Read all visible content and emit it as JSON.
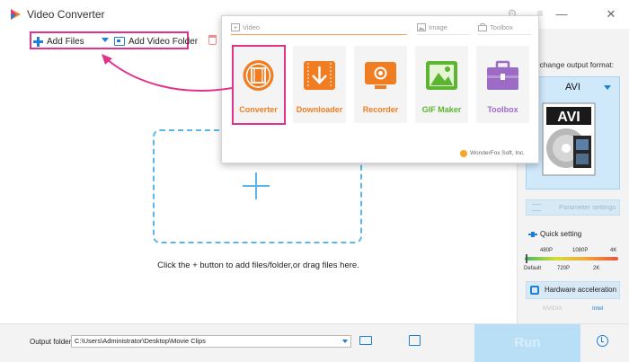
{
  "window": {
    "title": "Video Converter",
    "minimize_glyph": "—",
    "close_glyph": "✕"
  },
  "toolbar": {
    "add_files_label": "Add Files",
    "add_video_folder_label": "Add Video Folder"
  },
  "dropzone": {
    "hint": "Click the + button to add files/folder,or drag files here."
  },
  "right_panel": {
    "format_prompt": "to change output format:",
    "format_name": "AVI",
    "format_image_text": "AVI",
    "parameter_settings_label": "Parameter settings",
    "quick_setting_label": "Quick setting",
    "quality_ticks_top": [
      "480P",
      "1080P",
      "4K"
    ],
    "quality_ticks_bottom": [
      "Default",
      "720P",
      "2K"
    ],
    "hardware_acceleration_label": "Hardware acceleration",
    "vendors": [
      "NVIDIA",
      "Intel"
    ]
  },
  "bottom": {
    "output_folder_label": "Output folder:",
    "output_path": "C:\\Users\\Administrator\\Desktop\\Movie Clips",
    "run_label": "Run"
  },
  "popup": {
    "categories": [
      "Video",
      "Image",
      "Toolbox"
    ],
    "tools": [
      {
        "label": "Converter",
        "color": "#f07d22"
      },
      {
        "label": "Downloader",
        "color": "#f07d22"
      },
      {
        "label": "Recorder",
        "color": "#f07d22"
      },
      {
        "label": "GIF Maker",
        "color": "#5cb531"
      },
      {
        "label": "Toolbox",
        "color": "#9b6bc6"
      }
    ],
    "footer": "WonderFox Soft, Inc."
  },
  "colors": {
    "accent": "#1e7fd6",
    "highlight": "#e0348c",
    "run_disabled": "#b9dff6",
    "video_tab_underline": "#f6a35a"
  }
}
